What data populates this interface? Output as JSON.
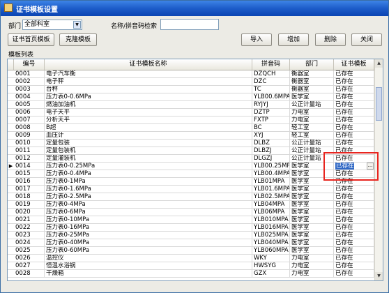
{
  "window": {
    "title": "证书模板设置"
  },
  "filter": {
    "dept_label": "部门",
    "dept_value": "全部科室",
    "search_label": "名称/拼音码检索",
    "search_value": ""
  },
  "toolbar": {
    "cover_template": "证书首页模板",
    "clone_template": "克隆模板",
    "import": "导入",
    "add": "增加",
    "delete": "删除",
    "close": "关闭"
  },
  "list": {
    "title": "模板列表",
    "columns": [
      "编号",
      "证书模板名称",
      "拼音码",
      "部门",
      "证书模板"
    ],
    "selected_index": 13,
    "rows": [
      {
        "id": "0001",
        "name": "电子汽车衡",
        "py": "DZQCH",
        "dept": "衡器室",
        "tpl": "已存在"
      },
      {
        "id": "0002",
        "name": "电子秤",
        "py": "DZC",
        "dept": "衡器室",
        "tpl": "已存在"
      },
      {
        "id": "0003",
        "name": "台秤",
        "py": "TC",
        "dept": "衡器室",
        "tpl": "已存在"
      },
      {
        "id": "0004",
        "name": "压力表0-0.6MPa",
        "py": "YLB00.6MPA",
        "dept": "医学室",
        "tpl": "已存在"
      },
      {
        "id": "0005",
        "name": "燃油加油机",
        "py": "RYJYJ",
        "dept": "公正计量站",
        "tpl": "已存在"
      },
      {
        "id": "0006",
        "name": "电子天平",
        "py": "DZTP",
        "dept": "力电室",
        "tpl": "已存在"
      },
      {
        "id": "0007",
        "name": "分析天平",
        "py": "FXTP",
        "dept": "力电室",
        "tpl": "已存在"
      },
      {
        "id": "0008",
        "name": "B超",
        "py": "BC",
        "dept": "轻工室",
        "tpl": "已存在"
      },
      {
        "id": "0009",
        "name": "血压计",
        "py": "XYJ",
        "dept": "轻工室",
        "tpl": "已存在"
      },
      {
        "id": "0010",
        "name": "定量包装",
        "py": "DLBZ",
        "dept": "公正计量站",
        "tpl": "已存在"
      },
      {
        "id": "0011",
        "name": "定量包装机",
        "py": "DLBZJ",
        "dept": "公正计量站",
        "tpl": "已存在"
      },
      {
        "id": "0012",
        "name": "定量灌装机",
        "py": "DLGZJ",
        "dept": "公正计量站",
        "tpl": "已存在"
      },
      {
        "id": "0014",
        "name": "压力表0-0.25MPa",
        "py": "YLB00.25MP",
        "dept": "医学室",
        "tpl": "已存在"
      },
      {
        "id": "0015",
        "name": "压力表0-0.4MPa",
        "py": "YLB00.4MPA",
        "dept": "医学室",
        "tpl": "已存在"
      },
      {
        "id": "0016",
        "name": "压力表0-1MPa",
        "py": "YLB01MPA",
        "dept": "医学室",
        "tpl": "已存在"
      },
      {
        "id": "0017",
        "name": "压力表0-1.6MPa",
        "py": "YLB01.6MPA",
        "dept": "医学室",
        "tpl": "已存在"
      },
      {
        "id": "0018",
        "name": "压力表0-2.5MPa",
        "py": "YLB02.5MPA",
        "dept": "医学室",
        "tpl": "已存在"
      },
      {
        "id": "0019",
        "name": "压力表0-4MPa",
        "py": "YLB04MPA",
        "dept": "医学室",
        "tpl": "已存在"
      },
      {
        "id": "0020",
        "name": "压力表0-6MPa",
        "py": "YLB06MPA",
        "dept": "医学室",
        "tpl": "已存在"
      },
      {
        "id": "0021",
        "name": "压力表0-10MPa",
        "py": "YLB010MPA",
        "dept": "医学室",
        "tpl": "已存在"
      },
      {
        "id": "0022",
        "name": "压力表0-16MPa",
        "py": "YLB016MPA",
        "dept": "医学室",
        "tpl": "已存在"
      },
      {
        "id": "0023",
        "name": "压力表0-25MPa",
        "py": "YLB025MPA",
        "dept": "医学室",
        "tpl": "已存在"
      },
      {
        "id": "0024",
        "name": "压力表0-40MPa",
        "py": "YLB040MPA",
        "dept": "医学室",
        "tpl": "已存在"
      },
      {
        "id": "0025",
        "name": "压力表0-60MPa",
        "py": "YLB060MPA",
        "dept": "医学室",
        "tpl": "已存在"
      },
      {
        "id": "0026",
        "name": "温控仪",
        "py": "WKY",
        "dept": "力电室",
        "tpl": "已存在"
      },
      {
        "id": "0027",
        "name": "恒温水浴锅",
        "py": "HWSYG",
        "dept": "力电室",
        "tpl": "已存在"
      },
      {
        "id": "0028",
        "name": "干燥箱",
        "py": "GZX",
        "dept": "力电室",
        "tpl": "已存在"
      }
    ]
  },
  "colors": {
    "title_bar": "#1d5cc9",
    "selection": "#3169c6",
    "highlight_box": "#e8251f"
  },
  "icons": {
    "row_indicator": "triangle-right-icon",
    "scroll_up": "chevron-up-icon",
    "scroll_down": "chevron-down-icon"
  }
}
